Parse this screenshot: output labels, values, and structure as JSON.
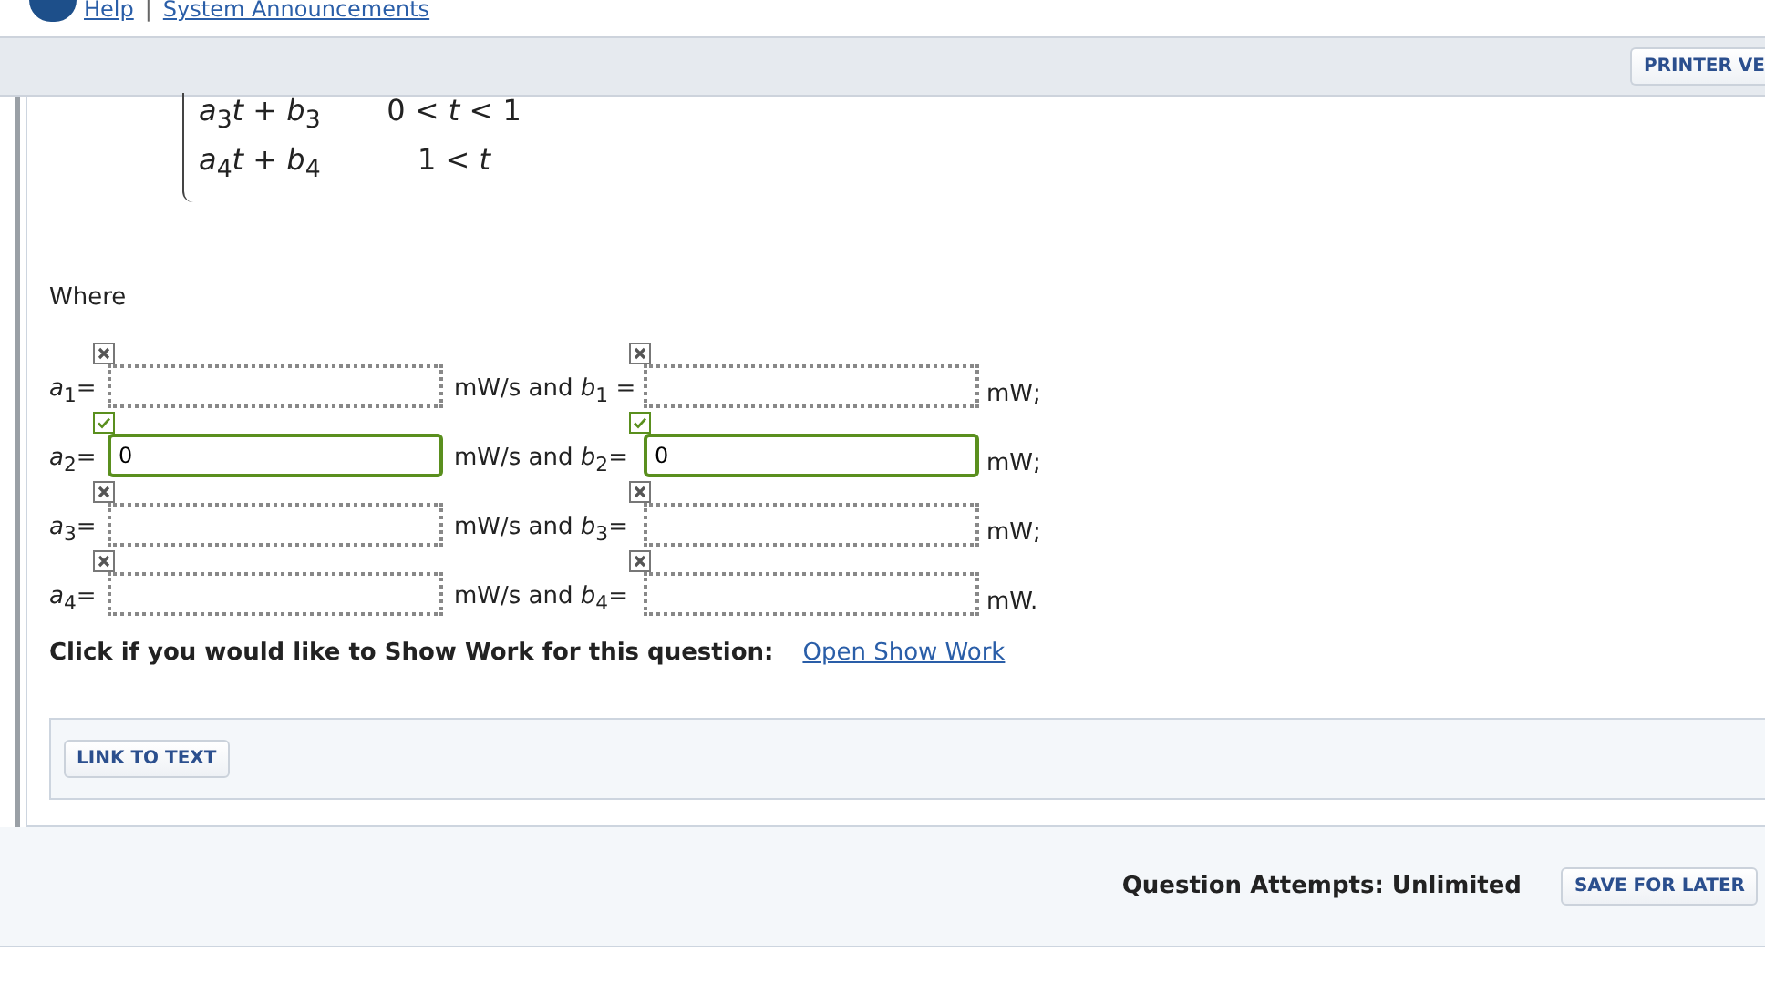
{
  "header_links": [
    "Help",
    "System Announcements"
  ],
  "header_separator": "|",
  "toolbar": {
    "button": "PRINTER VE"
  },
  "formula": {
    "rows": [
      {
        "expression": "*a*$_{3}$*t* + *b*$_{3}$",
        "condition": "0 < *t* < 1"
      },
      {
        "expression": "*a*$_{4}$*t* + *b*$_{4}$",
        "condition": "1 < *t*"
      }
    ]
  },
  "where": "Where",
  "answer_rows": [
    {
      "a_label": "*a*$_{1}$=",
      "a_field": {
        "correct": false
      },
      "middle": "mW/s and *b*$_{1}$ =",
      "b_field": {
        "correct": false
      },
      "unit": "mW;"
    },
    {
      "a_label": "*a*$_{2}$=",
      "a_field": {
        "correct": true,
        "value": "0"
      },
      "middle": "mW/s and *b*$_{2}$=",
      "b_field": {
        "correct": true,
        "value": "0"
      },
      "unit": "mW;"
    },
    {
      "a_label": "*a*$_{3}$=",
      "a_field": {
        "correct": false
      },
      "middle": "mW/s and *b*$_{3}$=",
      "b_field": {
        "correct": false
      },
      "unit": "mW;"
    },
    {
      "a_label": "*a*$_{4}$=",
      "a_field": {
        "correct": false
      },
      "middle": "mW/s and *b*$_{4}$=",
      "b_field": {
        "correct": false
      },
      "unit": "mW."
    }
  ],
  "show_work": {
    "prompt": "Click if you would like to Show Work for this question:",
    "link": "Open Show Work"
  },
  "link_button": "LINK TO TEXT",
  "footer": {
    "attempts": "Question Attempts: Unlimited",
    "button": "SAVE FOR LATER"
  }
}
